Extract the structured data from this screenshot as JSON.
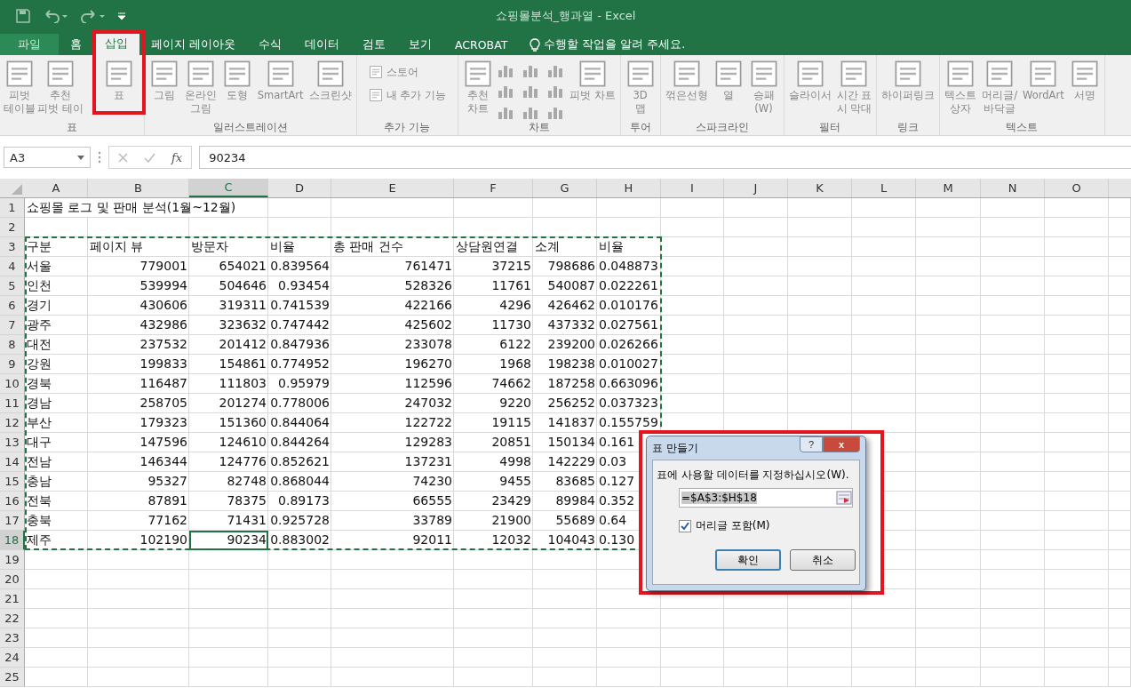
{
  "window": {
    "title": "쇼핑몰분석_행과열 - Excel"
  },
  "tabs": [
    {
      "label": "파일",
      "kind": "file",
      "selected": false
    },
    {
      "label": "홈",
      "kind": "tab",
      "selected": false
    },
    {
      "label": "삽입",
      "kind": "tab",
      "selected": true
    },
    {
      "label": "페이지 레이아웃",
      "kind": "tab",
      "selected": false
    },
    {
      "label": "수식",
      "kind": "tab",
      "selected": false
    },
    {
      "label": "데이터",
      "kind": "tab",
      "selected": false
    },
    {
      "label": "검토",
      "kind": "tab",
      "selected": false
    },
    {
      "label": "보기",
      "kind": "tab",
      "selected": false
    },
    {
      "label": "ACROBAT",
      "kind": "tab",
      "selected": false
    }
  ],
  "tell_me": {
    "placeholder": "수행할 작업을 알려 주세요."
  },
  "ribbon": [
    {
      "label": "표",
      "items": [
        {
          "kind": "large",
          "label": "피벗\n테이블"
        },
        {
          "kind": "large",
          "label": "추천\n피벗 테이"
        },
        {
          "kind": "large",
          "label": "표"
        }
      ]
    },
    {
      "label": "일러스트레이션",
      "items": [
        {
          "kind": "large",
          "label": "그림"
        },
        {
          "kind": "large",
          "label": "온라인\n그림"
        },
        {
          "kind": "large",
          "label": "도형"
        },
        {
          "kind": "large",
          "label": "SmartArt"
        },
        {
          "kind": "large",
          "label": "스크린샷"
        }
      ]
    },
    {
      "label": "추가 기능",
      "items": [
        {
          "kind": "small",
          "label": "스토어"
        },
        {
          "kind": "small",
          "label": "내 추가 기능"
        }
      ]
    },
    {
      "label": "차트",
      "items": [
        {
          "kind": "large",
          "label": "추천\n차트"
        },
        {
          "kind": "grid"
        },
        {
          "kind": "large",
          "label": "피벗 차트"
        }
      ]
    },
    {
      "label": "투어",
      "items": [
        {
          "kind": "large",
          "label": "3D\n맵"
        }
      ]
    },
    {
      "label": "스파크라인",
      "items": [
        {
          "kind": "large",
          "label": "꺾은선형"
        },
        {
          "kind": "large",
          "label": "열"
        },
        {
          "kind": "large",
          "label": "승패\n(W)"
        }
      ]
    },
    {
      "label": "필터",
      "items": [
        {
          "kind": "large",
          "label": "슬라이서"
        },
        {
          "kind": "large",
          "label": "시간 표\n시 막대"
        }
      ]
    },
    {
      "label": "링크",
      "items": [
        {
          "kind": "large",
          "label": "하이퍼링크"
        }
      ]
    },
    {
      "label": "텍스트",
      "items": [
        {
          "kind": "large",
          "label": "텍스트\n상자"
        },
        {
          "kind": "large",
          "label": "머리글/\n바닥글"
        },
        {
          "kind": "large",
          "label": "WordArt"
        },
        {
          "kind": "large",
          "label": "서명"
        }
      ]
    }
  ],
  "formula_bar": {
    "name_box": "A3",
    "fx": "fx",
    "value": "90234"
  },
  "columns": [
    {
      "label": "A",
      "selected": false
    },
    {
      "label": "B",
      "selected": false
    },
    {
      "label": "C",
      "selected": true
    },
    {
      "label": "D",
      "selected": false
    },
    {
      "label": "E",
      "selected": false
    },
    {
      "label": "F",
      "selected": false
    },
    {
      "label": "G",
      "selected": false
    },
    {
      "label": "H",
      "selected": false
    },
    {
      "label": "I",
      "selected": false
    },
    {
      "label": "J",
      "selected": false
    },
    {
      "label": "K",
      "selected": false
    },
    {
      "label": "L",
      "selected": false
    },
    {
      "label": "M",
      "selected": false
    },
    {
      "label": "N",
      "selected": false
    },
    {
      "label": "O",
      "selected": false
    }
  ],
  "rows": [
    {
      "number": "1",
      "kind": "title",
      "selected": false,
      "cells": [
        "쇼핑몰 로그 및 판매 분석(1월~12월)"
      ]
    },
    {
      "number": "2",
      "kind": "empty",
      "selected": false
    },
    {
      "number": "3",
      "kind": "header",
      "selected": false,
      "cells": [
        "구분",
        "페이지 뷰",
        "방문자",
        "비율",
        "총 판매 건수",
        "상담원연결",
        "소계",
        "비율"
      ]
    },
    {
      "number": "4",
      "kind": "data",
      "selected": false,
      "cells": [
        "서울",
        "779001",
        "654021",
        "0.839564",
        "761471",
        "37215",
        "798686",
        "0.048873"
      ]
    },
    {
      "number": "5",
      "kind": "data",
      "selected": false,
      "cells": [
        "인천",
        "539994",
        "504646",
        "0.93454",
        "528326",
        "11761",
        "540087",
        "0.022261"
      ]
    },
    {
      "number": "6",
      "kind": "data",
      "selected": false,
      "cells": [
        "경기",
        "430606",
        "319311",
        "0.741539",
        "422166",
        "4296",
        "426462",
        "0.010176"
      ]
    },
    {
      "number": "7",
      "kind": "data",
      "selected": false,
      "cells": [
        "광주",
        "432986",
        "323632",
        "0.747442",
        "425602",
        "11730",
        "437332",
        "0.027561"
      ]
    },
    {
      "number": "8",
      "kind": "data",
      "selected": false,
      "cells": [
        "대전",
        "237532",
        "201412",
        "0.847936",
        "233078",
        "6122",
        "239200",
        "0.026266"
      ]
    },
    {
      "number": "9",
      "kind": "data",
      "selected": false,
      "cells": [
        "강원",
        "199833",
        "154861",
        "0.774952",
        "196270",
        "1968",
        "198238",
        "0.010027"
      ]
    },
    {
      "number": "10",
      "kind": "data",
      "selected": false,
      "cells": [
        "경북",
        "116487",
        "111803",
        "0.95979",
        "112596",
        "74662",
        "187258",
        "0.663096"
      ]
    },
    {
      "number": "11",
      "kind": "data",
      "selected": false,
      "cells": [
        "경남",
        "258705",
        "201274",
        "0.778006",
        "247032",
        "9220",
        "256252",
        "0.037323"
      ]
    },
    {
      "number": "12",
      "kind": "data",
      "selected": false,
      "cells": [
        "부산",
        "179323",
        "151360",
        "0.844064",
        "122722",
        "19115",
        "141837",
        "0.155759"
      ]
    },
    {
      "number": "13",
      "kind": "data",
      "selected": false,
      "cells": [
        "대구",
        "147596",
        "124610",
        "0.844264",
        "129283",
        "20851",
        "150134",
        "0.161"
      ]
    },
    {
      "number": "14",
      "kind": "data",
      "selected": false,
      "cells": [
        "전남",
        "146344",
        "124776",
        "0.852621",
        "137231",
        "4998",
        "142229",
        "0.03"
      ]
    },
    {
      "number": "15",
      "kind": "data",
      "selected": false,
      "cells": [
        "충남",
        "95327",
        "82748",
        "0.868044",
        "74230",
        "9455",
        "83685",
        "0.127"
      ]
    },
    {
      "number": "16",
      "kind": "data",
      "selected": false,
      "cells": [
        "전북",
        "87891",
        "78375",
        "0.89173",
        "66555",
        "23429",
        "89984",
        "0.352"
      ]
    },
    {
      "number": "17",
      "kind": "data",
      "selected": false,
      "cells": [
        "충북",
        "77162",
        "71431",
        "0.925728",
        "33789",
        "21900",
        "55689",
        "0.64"
      ]
    },
    {
      "number": "18",
      "kind": "data",
      "selected": true,
      "cells": [
        "제주",
        "102190",
        "90234",
        "0.883002",
        "92011",
        "12032",
        "104043",
        "0.130"
      ]
    },
    {
      "number": "19",
      "kind": "empty",
      "selected": false
    },
    {
      "number": "20",
      "kind": "empty",
      "selected": false
    },
    {
      "number": "21",
      "kind": "empty",
      "selected": false
    },
    {
      "number": "22",
      "kind": "empty",
      "selected": false
    },
    {
      "number": "23",
      "kind": "empty",
      "selected": false
    },
    {
      "number": "24",
      "kind": "empty",
      "selected": false
    },
    {
      "number": "25",
      "kind": "empty",
      "selected": false
    }
  ],
  "dialog": {
    "title": "표 만들기",
    "help": "?",
    "close": "x",
    "prompt": "표에 사용할 데이터를 지정하십시오(W).",
    "range": "=$A$3:$H$18",
    "checkbox": {
      "label": "머리글 포함(M)",
      "checked": true
    },
    "buttons": [
      {
        "label": "확인",
        "kind": "default"
      },
      {
        "label": "취소",
        "kind": "normal"
      }
    ]
  }
}
